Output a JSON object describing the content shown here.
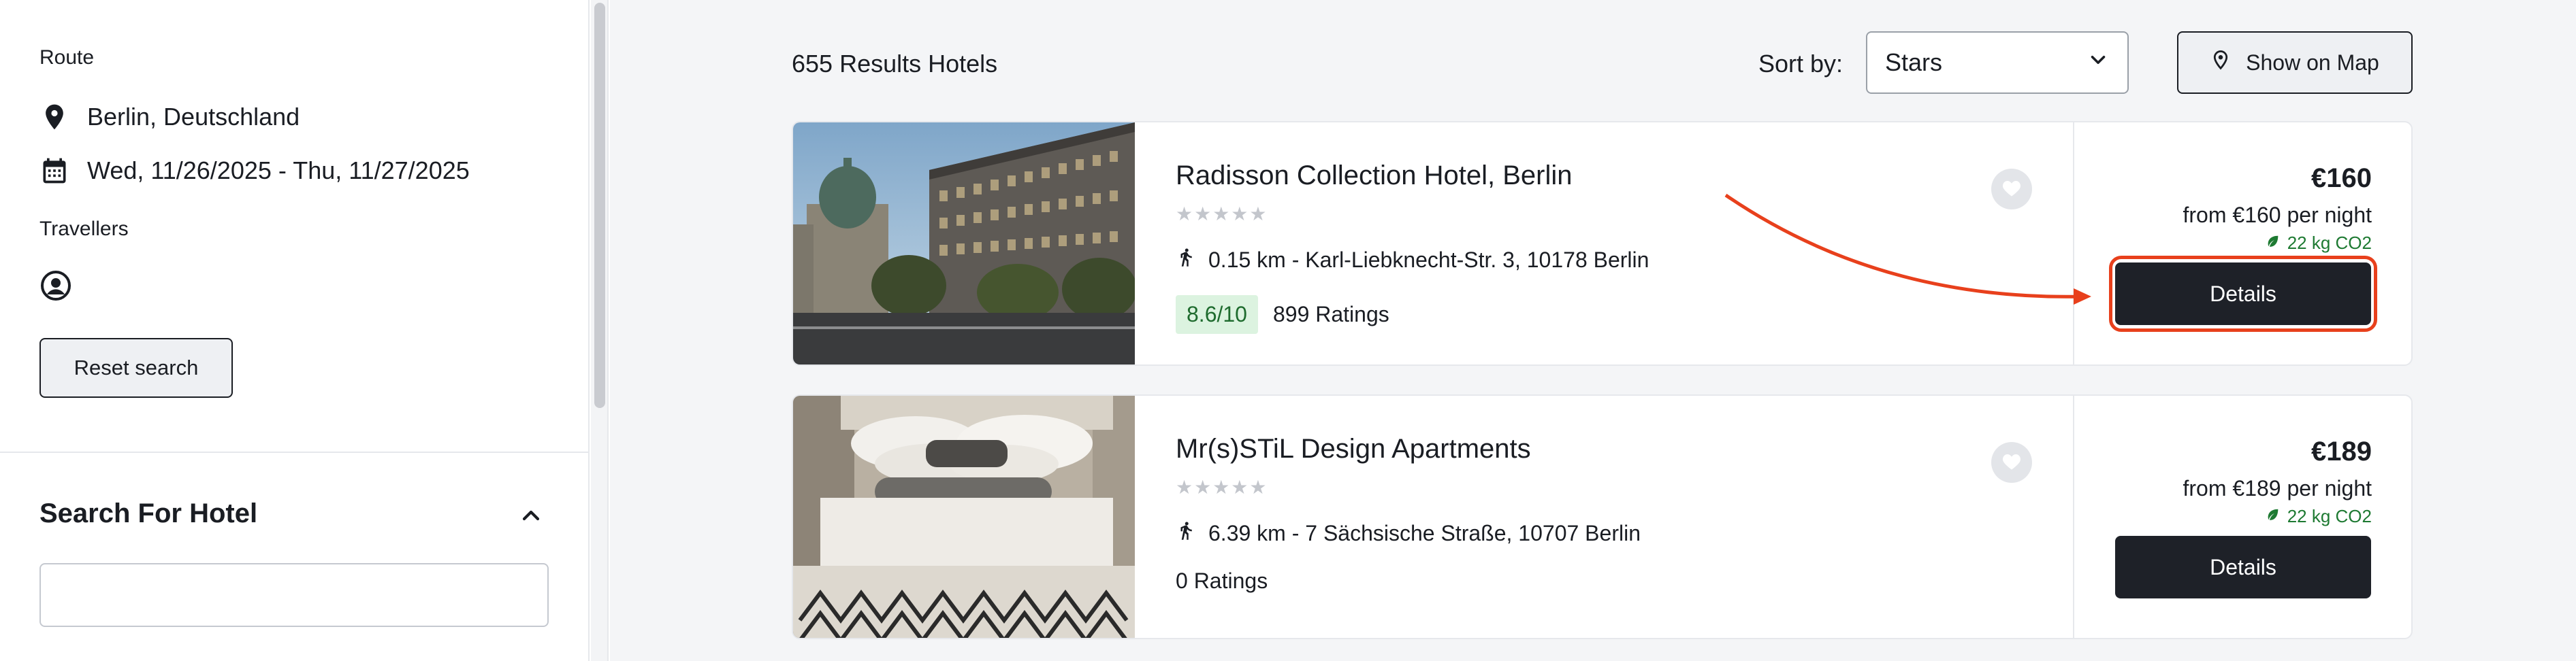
{
  "sidebar": {
    "route_label": "Route",
    "location": "Berlin, Deutschland",
    "dates": "Wed, 11/26/2025 - Thu, 11/27/2025",
    "travellers_label": "Travellers",
    "reset_label": "Reset search",
    "search_section_title": "Search For Hotel",
    "search_value": ""
  },
  "results": {
    "count_text": "655 Results Hotels",
    "sort_label": "Sort by:",
    "sort_value": "Stars",
    "map_button_label": "Show on Map"
  },
  "hotels": [
    {
      "name": "Radisson Collection Hotel, Berlin",
      "stars": "★★★★★",
      "address": "0.15 km - Karl-Liebknecht-Str. 3, 10178 Berlin",
      "score": "8.6/10",
      "ratings": "899 Ratings",
      "price": "€160",
      "per_night": "from €160 per night",
      "co2": "22 kg CO2",
      "details_label": "Details"
    },
    {
      "name": "Mr(s)STiL Design Apartments",
      "stars": "★★★★★",
      "address": "6.39 km - 7 Sächsische Straße, 10707 Berlin",
      "score": "",
      "ratings": "0 Ratings",
      "price": "€189",
      "per_night": "from €189 per night",
      "co2": "22 kg CO2",
      "details_label": "Details"
    }
  ],
  "icons": {
    "location": "location-pin-icon",
    "calendar": "calendar-icon",
    "traveller": "user-circle-icon",
    "chevron_up": "chevron-up-icon",
    "chevron_down": "chevron-down-icon",
    "map_pin": "map-pin-icon",
    "walk": "walking-person-icon",
    "heart": "heart-icon",
    "leaf": "leaf-icon"
  },
  "colors": {
    "primary_dark": "#1e2128",
    "rating_bg": "#dcf3e0",
    "rating_text": "#1e6b2e",
    "co2_green": "#1e7a32",
    "annotation_red": "#e8401c"
  }
}
